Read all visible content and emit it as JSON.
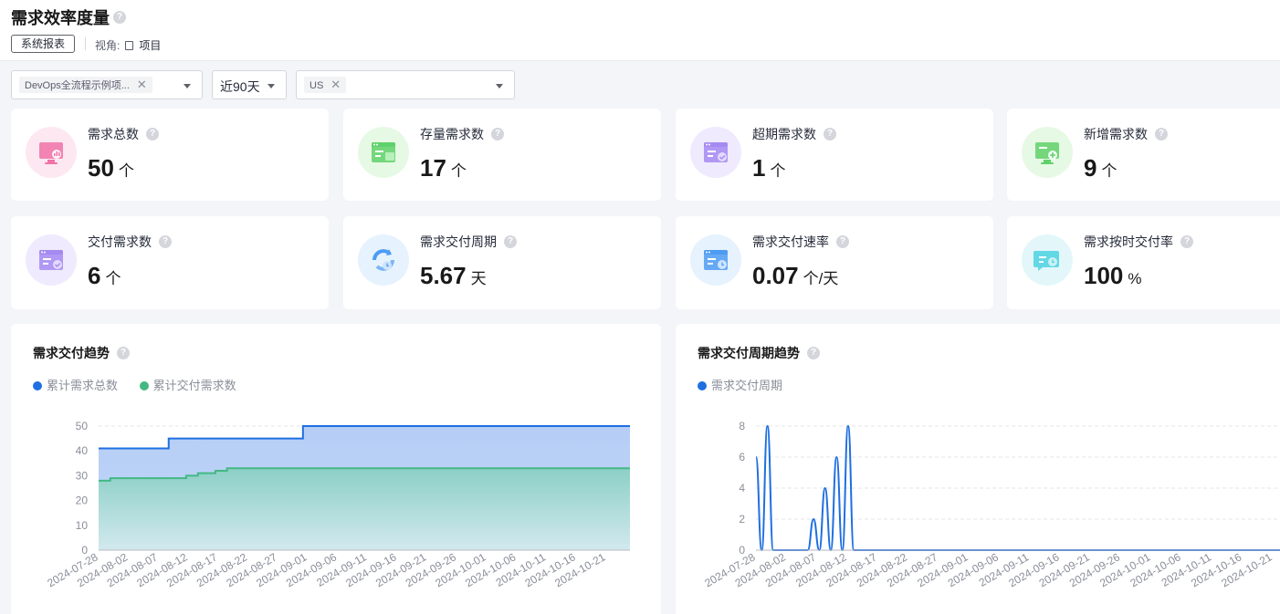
{
  "header": {
    "title": "需求效率度量",
    "help_glyph": "?",
    "system_report_label": "系统报表",
    "view_label": "视角:",
    "view_value": "项目"
  },
  "filters": {
    "project_tag": "DevOps全流程示例项...",
    "period": "近90天",
    "type_tag": "US",
    "remove_glyph": "✕"
  },
  "metrics": [
    {
      "label": "需求总数",
      "value": "50",
      "unit": "个",
      "icon": "monitor-chart-icon",
      "bg": "#fde8f1",
      "color": "#f072a8"
    },
    {
      "label": "存量需求数",
      "value": "17",
      "unit": "个",
      "icon": "window-list-icon",
      "bg": "#e6f9e4",
      "color": "#5fd16a"
    },
    {
      "label": "超期需求数",
      "value": "1",
      "unit": "个",
      "icon": "window-check-icon",
      "bg": "#efeafd",
      "color": "#a58af2"
    },
    {
      "label": "新增需求数",
      "value": "9",
      "unit": "个",
      "icon": "monitor-plus-icon",
      "bg": "#e6f9e4",
      "color": "#5fd16a"
    },
    {
      "label": "交付需求数",
      "value": "6",
      "unit": "个",
      "icon": "window-check-icon",
      "bg": "#efeafd",
      "color": "#a58af2"
    },
    {
      "label": "需求交付周期",
      "value": "5.67",
      "unit": "天",
      "icon": "cycle-clock-icon",
      "bg": "#e6f2fd",
      "color": "#4d9cf3"
    },
    {
      "label": "需求交付速率",
      "value": "0.07",
      "unit": "个/天",
      "icon": "window-clock-icon",
      "bg": "#e6f2fd",
      "color": "#4d9cf3"
    },
    {
      "label": "需求按时交付率",
      "value": "100",
      "unit": "%",
      "icon": "chat-clock-icon",
      "bg": "#e3f7fa",
      "color": "#4cd2e0"
    }
  ],
  "chart_data": [
    {
      "type": "area",
      "title": "需求交付趋势",
      "series": [
        {
          "name": "累计需求总数",
          "color": "#1f6fe1",
          "values": [
            41,
            41,
            41,
            41,
            41,
            41,
            41,
            41,
            41,
            41,
            41,
            41,
            45,
            45,
            45,
            45,
            45,
            45,
            45,
            45,
            45,
            45,
            45,
            45,
            45,
            45,
            45,
            45,
            45,
            45,
            45,
            45,
            45,
            45,
            45,
            50,
            50,
            50,
            50,
            50,
            50,
            50,
            50,
            50,
            50,
            50,
            50,
            50,
            50,
            50,
            50,
            50,
            50,
            50,
            50,
            50,
            50,
            50,
            50,
            50,
            50,
            50,
            50,
            50,
            50,
            50,
            50,
            50,
            50,
            50,
            50,
            50,
            50,
            50,
            50,
            50,
            50,
            50,
            50,
            50,
            50,
            50,
            50,
            50,
            50,
            50,
            50,
            50,
            50,
            50,
            50,
            50
          ]
        },
        {
          "name": "累计交付需求数",
          "color": "#43b883",
          "values": [
            28,
            28,
            29,
            29,
            29,
            29,
            29,
            29,
            29,
            29,
            29,
            29,
            29,
            29,
            29,
            30,
            30,
            31,
            31,
            31,
            32,
            32,
            33,
            33,
            33,
            33,
            33,
            33,
            33,
            33,
            33,
            33,
            33,
            33,
            33,
            33,
            33,
            33,
            33,
            33,
            33,
            33,
            33,
            33,
            33,
            33,
            33,
            33,
            33,
            33,
            33,
            33,
            33,
            33,
            33,
            33,
            33,
            33,
            33,
            33,
            33,
            33,
            33,
            33,
            33,
            33,
            33,
            33,
            33,
            33,
            33,
            33,
            33,
            33,
            33,
            33,
            33,
            33,
            33,
            33,
            33,
            33,
            33,
            33,
            33,
            33,
            33,
            33,
            33,
            33,
            33,
            33
          ]
        }
      ],
      "x_ticks": [
        "2024-07-28",
        "2024-08-02",
        "2024-08-07",
        "2024-08-12",
        "2024-08-17",
        "2024-08-22",
        "2024-08-27",
        "2024-09-01",
        "2024-09-06",
        "2024-09-11",
        "2024-09-16",
        "2024-09-21",
        "2024-09-26",
        "2024-10-01",
        "2024-10-06",
        "2024-10-11",
        "2024-10-16",
        "2024-10-21"
      ],
      "ylim": [
        0,
        50
      ],
      "y_ticks": [
        0,
        10,
        20,
        30,
        40,
        50
      ],
      "grid": true,
      "legend": "top-left"
    },
    {
      "type": "line",
      "title": "需求交付周期趋势",
      "series": [
        {
          "name": "需求交付周期",
          "color": "#1f6fe1",
          "values": [
            6,
            0,
            8,
            0,
            0,
            0,
            0,
            0,
            0,
            0,
            2,
            0,
            4,
            0,
            6,
            0,
            8,
            0,
            0,
            0,
            0,
            0,
            0,
            0,
            0,
            0,
            0,
            0,
            0,
            0,
            0,
            0,
            0,
            0,
            0,
            0,
            0,
            0,
            0,
            0,
            0,
            0,
            0,
            0,
            0,
            0,
            0,
            0,
            0,
            0,
            0,
            0,
            0,
            0,
            0,
            0,
            0,
            0,
            0,
            0,
            0,
            0,
            0,
            0,
            0,
            0,
            0,
            0,
            0,
            0,
            0,
            0,
            0,
            0,
            0,
            0,
            0,
            0,
            0,
            0,
            0,
            0,
            0,
            0,
            0,
            0,
            0,
            0,
            0,
            0,
            0,
            0
          ]
        }
      ],
      "x_ticks": [
        "2024-07-28",
        "2024-08-02",
        "2024-08-07",
        "2024-08-12",
        "2024-08-17",
        "2024-08-22",
        "2024-08-27",
        "2024-09-01",
        "2024-09-06",
        "2024-09-11",
        "2024-09-16",
        "2024-09-21",
        "2024-09-26",
        "2024-10-01",
        "2024-10-06",
        "2024-10-11",
        "2024-10-16",
        "2024-10-21"
      ],
      "ylim": [
        0,
        8
      ],
      "y_ticks": [
        0,
        2,
        4,
        6,
        8
      ],
      "grid": true,
      "legend": "top-left"
    }
  ]
}
